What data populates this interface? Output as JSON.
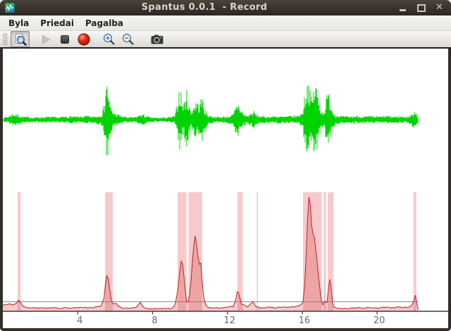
{
  "window": {
    "title": "Spantus 0.0.1  - Record",
    "app_icon": "spantus-app-icon",
    "controls": [
      {
        "name": "minimize"
      },
      {
        "name": "maximize"
      },
      {
        "name": "close",
        "glyph": "✕"
      }
    ]
  },
  "menubar": {
    "items": [
      {
        "label": "Byla"
      },
      {
        "label": "Priedai"
      },
      {
        "label": "Pagalba"
      }
    ]
  },
  "toolbar": {
    "buttons": [
      {
        "name": "inspect",
        "icon": "magnifier-document-icon",
        "state": "pressed"
      },
      {
        "name": "play",
        "icon": "play-icon",
        "state": "disabled"
      },
      {
        "name": "stop",
        "icon": "stop-icon",
        "state": "normal"
      },
      {
        "name": "record",
        "icon": "record-icon",
        "state": "normal"
      },
      {
        "name": "zoom-in",
        "icon": "zoom-in-icon",
        "state": "normal"
      },
      {
        "name": "zoom-out",
        "icon": "zoom-out-icon",
        "state": "normal"
      },
      {
        "name": "snapshot",
        "icon": "camera-icon",
        "state": "normal"
      }
    ]
  },
  "colors": {
    "waveform_green": "#00d300",
    "energy_red": "#bf2d31",
    "energy_fill": "rgba(214,69,69,0.28)",
    "segment_band": "rgba(233,113,117,0.38)",
    "threshold_gray": "#8a8a8a",
    "axis_dark": "#3f3b38",
    "tick_label": "#6b6866",
    "titlebar_brown": "#39322b"
  },
  "chart_data": [
    {
      "id": "waveform",
      "type": "line",
      "title": "recorded audio waveform",
      "color": "#00d300",
      "x_range": [
        0,
        23.8
      ],
      "signal_end": 22.2,
      "grid": false,
      "envelope": [
        [
          0,
          3
        ],
        [
          0.3,
          5
        ],
        [
          0.45,
          8
        ],
        [
          0.6,
          9
        ],
        [
          0.8,
          7
        ],
        [
          1.0,
          5
        ],
        [
          1.3,
          4
        ],
        [
          1.7,
          3.5
        ],
        [
          2.1,
          4
        ],
        [
          2.5,
          4.5
        ],
        [
          2.9,
          3.5
        ],
        [
          3.3,
          4.5
        ],
        [
          3.7,
          5
        ],
        [
          4.0,
          4
        ],
        [
          4.4,
          5.5
        ],
        [
          4.8,
          4.5
        ],
        [
          5.1,
          6
        ],
        [
          5.3,
          9
        ],
        [
          5.42,
          22
        ],
        [
          5.52,
          58
        ],
        [
          5.62,
          45
        ],
        [
          5.72,
          20
        ],
        [
          5.85,
          12
        ],
        [
          6.0,
          10
        ],
        [
          6.2,
          7
        ],
        [
          6.5,
          4.5
        ],
        [
          6.8,
          3.5
        ],
        [
          7.1,
          4
        ],
        [
          7.3,
          7
        ],
        [
          7.45,
          8
        ],
        [
          7.65,
          5
        ],
        [
          8.0,
          3
        ],
        [
          8.5,
          3
        ],
        [
          9.0,
          4
        ],
        [
          9.2,
          6
        ],
        [
          9.32,
          22
        ],
        [
          9.42,
          44
        ],
        [
          9.52,
          38
        ],
        [
          9.62,
          20
        ],
        [
          9.72,
          28
        ],
        [
          9.82,
          40
        ],
        [
          9.92,
          24
        ],
        [
          10.05,
          12
        ],
        [
          10.2,
          20
        ],
        [
          10.35,
          26
        ],
        [
          10.5,
          20
        ],
        [
          10.6,
          30
        ],
        [
          10.7,
          28
        ],
        [
          10.8,
          14
        ],
        [
          10.95,
          7
        ],
        [
          11.2,
          5
        ],
        [
          11.6,
          4
        ],
        [
          12.0,
          5
        ],
        [
          12.3,
          7
        ],
        [
          12.45,
          18
        ],
        [
          12.58,
          25
        ],
        [
          12.7,
          16
        ],
        [
          12.85,
          9
        ],
        [
          13.05,
          6
        ],
        [
          13.25,
          9
        ],
        [
          13.4,
          12
        ],
        [
          13.55,
          7
        ],
        [
          13.8,
          5
        ],
        [
          14.2,
          4.5
        ],
        [
          14.6,
          5.5
        ],
        [
          15.0,
          4.5
        ],
        [
          15.4,
          5.5
        ],
        [
          15.75,
          6
        ],
        [
          16.0,
          10
        ],
        [
          16.12,
          30
        ],
        [
          16.22,
          48
        ],
        [
          16.32,
          58
        ],
        [
          16.42,
          38
        ],
        [
          16.52,
          28
        ],
        [
          16.62,
          44
        ],
        [
          16.72,
          52
        ],
        [
          16.82,
          36
        ],
        [
          16.92,
          24
        ],
        [
          17.02,
          14
        ],
        [
          17.12,
          11
        ],
        [
          17.22,
          18
        ],
        [
          17.32,
          34
        ],
        [
          17.42,
          38
        ],
        [
          17.52,
          26
        ],
        [
          17.62,
          13
        ],
        [
          17.78,
          7
        ],
        [
          18.1,
          5
        ],
        [
          18.5,
          4.5
        ],
        [
          18.9,
          5.5
        ],
        [
          19.3,
          4.5
        ],
        [
          19.7,
          5
        ],
        [
          20.1,
          4.5
        ],
        [
          20.5,
          5.5
        ],
        [
          20.9,
          4.5
        ],
        [
          21.3,
          5
        ],
        [
          21.6,
          4.5
        ],
        [
          21.85,
          7
        ],
        [
          22.0,
          14
        ],
        [
          22.1,
          11
        ],
        [
          22.2,
          3
        ]
      ]
    },
    {
      "id": "energy",
      "type": "area",
      "title": "energy envelope with detected speech segments",
      "color": "#bf2d31",
      "fill": "rgba(214,69,69,0.28)",
      "grid": false,
      "x_axis": {
        "ticks": [
          4,
          8,
          12,
          16,
          20
        ],
        "range": [
          0,
          23.8
        ]
      },
      "threshold": 13.5,
      "signal_end": 22.2,
      "segments": [
        [
          0.79,
          0.94
        ],
        [
          5.46,
          5.87
        ],
        [
          9.34,
          9.81
        ],
        [
          9.92,
          10.65
        ],
        [
          12.54,
          12.82
        ],
        [
          13.57,
          13.63
        ],
        [
          16.04,
          17.04
        ],
        [
          17.14,
          17.27
        ],
        [
          17.36,
          17.67
        ],
        [
          21.94,
          22.1
        ]
      ],
      "points": [
        [
          0,
          8
        ],
        [
          0.1,
          10
        ],
        [
          0.2,
          9
        ],
        [
          0.35,
          11
        ],
        [
          0.5,
          9
        ],
        [
          0.62,
          10
        ],
        [
          0.75,
          12
        ],
        [
          0.85,
          17
        ],
        [
          0.95,
          12
        ],
        [
          1.05,
          8
        ],
        [
          1.25,
          6
        ],
        [
          1.5,
          5
        ],
        [
          1.8,
          4.5
        ],
        [
          2.1,
          5
        ],
        [
          2.4,
          4.5
        ],
        [
          2.7,
          5.5
        ],
        [
          3.0,
          4.5
        ],
        [
          3.3,
          5
        ],
        [
          3.6,
          4.5
        ],
        [
          3.9,
          5.5
        ],
        [
          4.2,
          6
        ],
        [
          4.5,
          5
        ],
        [
          4.8,
          5.5
        ],
        [
          5.05,
          6
        ],
        [
          5.25,
          8
        ],
        [
          5.4,
          18
        ],
        [
          5.5,
          44
        ],
        [
          5.57,
          53
        ],
        [
          5.65,
          44
        ],
        [
          5.75,
          22
        ],
        [
          5.85,
          12
        ],
        [
          5.95,
          10
        ],
        [
          6.05,
          12
        ],
        [
          6.15,
          8
        ],
        [
          6.35,
          5
        ],
        [
          6.6,
          4
        ],
        [
          6.9,
          4.5
        ],
        [
          7.1,
          5
        ],
        [
          7.25,
          9
        ],
        [
          7.33,
          14
        ],
        [
          7.45,
          7
        ],
        [
          7.6,
          4
        ],
        [
          7.9,
          3.5
        ],
        [
          8.3,
          4
        ],
        [
          8.7,
          3.5
        ],
        [
          9.0,
          4
        ],
        [
          9.2,
          8
        ],
        [
          9.35,
          30
        ],
        [
          9.48,
          62
        ],
        [
          9.55,
          76
        ],
        [
          9.63,
          62
        ],
        [
          9.73,
          34
        ],
        [
          9.83,
          12
        ],
        [
          9.93,
          14
        ],
        [
          10.03,
          34
        ],
        [
          10.13,
          70
        ],
        [
          10.22,
          100
        ],
        [
          10.27,
          109
        ],
        [
          10.32,
          88
        ],
        [
          10.37,
          99
        ],
        [
          10.43,
          76
        ],
        [
          10.48,
          62
        ],
        [
          10.53,
          74
        ],
        [
          10.58,
          68
        ],
        [
          10.65,
          42
        ],
        [
          10.72,
          22
        ],
        [
          10.82,
          10
        ],
        [
          10.95,
          6
        ],
        [
          11.2,
          4.5
        ],
        [
          11.6,
          5
        ],
        [
          12.0,
          5.5
        ],
        [
          12.3,
          7
        ],
        [
          12.45,
          16
        ],
        [
          12.55,
          32
        ],
        [
          12.62,
          24
        ],
        [
          12.75,
          10
        ],
        [
          12.9,
          9
        ],
        [
          13.05,
          6
        ],
        [
          13.25,
          11
        ],
        [
          13.38,
          14
        ],
        [
          13.52,
          7
        ],
        [
          13.75,
          5
        ],
        [
          14.1,
          5.5
        ],
        [
          14.5,
          5
        ],
        [
          14.9,
          6
        ],
        [
          15.3,
          5.5
        ],
        [
          15.7,
          7
        ],
        [
          15.95,
          9
        ],
        [
          16.08,
          16
        ],
        [
          16.18,
          60
        ],
        [
          16.28,
          128
        ],
        [
          16.36,
          167
        ],
        [
          16.44,
          150
        ],
        [
          16.5,
          122
        ],
        [
          16.56,
          108
        ],
        [
          16.62,
          112
        ],
        [
          16.68,
          98
        ],
        [
          16.76,
          80
        ],
        [
          16.84,
          58
        ],
        [
          16.9,
          42
        ],
        [
          16.97,
          26
        ],
        [
          17.03,
          14
        ],
        [
          17.1,
          9
        ],
        [
          17.16,
          14
        ],
        [
          17.22,
          15
        ],
        [
          17.28,
          10
        ],
        [
          17.35,
          14
        ],
        [
          17.42,
          40
        ],
        [
          17.47,
          46
        ],
        [
          17.53,
          36
        ],
        [
          17.6,
          14
        ],
        [
          17.7,
          6
        ],
        [
          17.9,
          4
        ],
        [
          18.2,
          3.5
        ],
        [
          18.6,
          4.5
        ],
        [
          19.0,
          5
        ],
        [
          19.3,
          4
        ],
        [
          19.6,
          5.5
        ],
        [
          19.9,
          4.5
        ],
        [
          20.2,
          5
        ],
        [
          20.5,
          6
        ],
        [
          20.8,
          5
        ],
        [
          21.1,
          6
        ],
        [
          21.4,
          5
        ],
        [
          21.7,
          6
        ],
        [
          21.88,
          9
        ],
        [
          21.98,
          16
        ],
        [
          22.05,
          23
        ],
        [
          22.12,
          12
        ],
        [
          22.2,
          2
        ]
      ]
    }
  ]
}
